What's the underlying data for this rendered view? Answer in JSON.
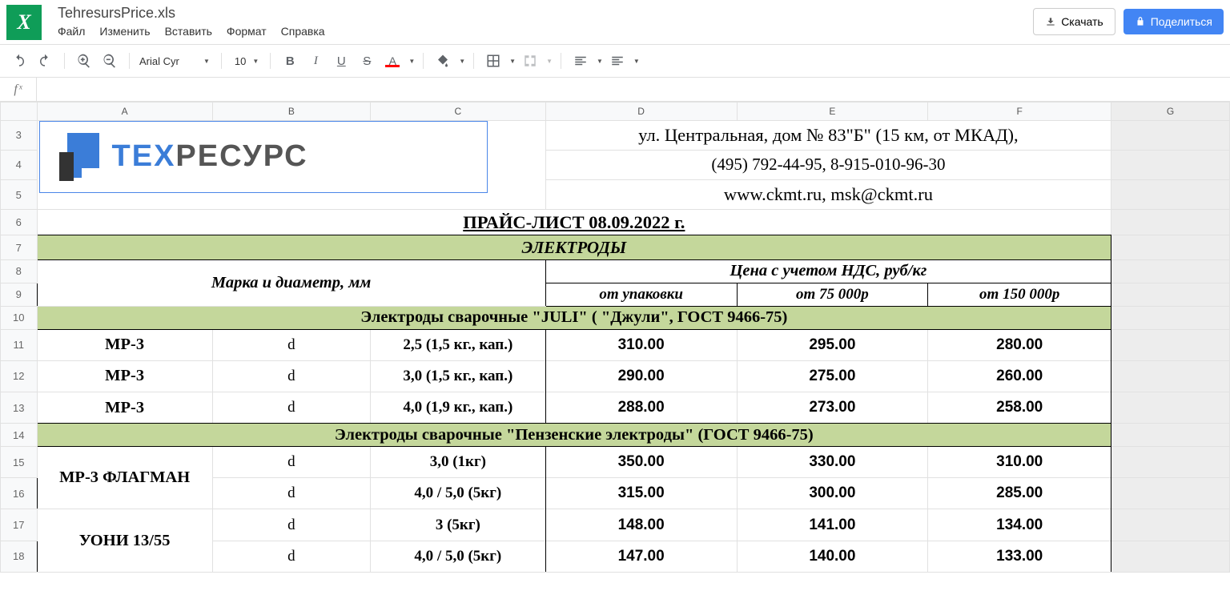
{
  "doc_title": "TehresursPrice.xls",
  "menu": [
    "Файл",
    "Изменить",
    "Вставить",
    "Формат",
    "Справка"
  ],
  "buttons": {
    "download": "Скачать",
    "share": "Поделиться"
  },
  "toolbar": {
    "font": "Arial Cyr",
    "font_size": "10"
  },
  "fx_label": "f ˣ",
  "columns": [
    "A",
    "B",
    "C",
    "D",
    "E",
    "F",
    "G"
  ],
  "rows": [
    "3",
    "4",
    "5",
    "6",
    "7",
    "8",
    "9",
    "10",
    "11",
    "12",
    "13",
    "14",
    "15",
    "16",
    "17",
    "18"
  ],
  "logo": {
    "blue": "ТЕХ",
    "gray": "РЕСУРС"
  },
  "address": {
    "line1": "ул. Центральная, дом № 83\"Б\" (15 км, от МКАД),",
    "line2": "(495) 792-44-95, 8-915-010-96-30",
    "line3": "www.ckmt.ru, msk@ckmt.ru"
  },
  "price_title": "ПРАЙС-ЛИСТ 08.09.2022 г.",
  "section": "ЭЛЕКТРОДЫ",
  "headers": {
    "brand": "Марка и диаметр, мм",
    "price": "Цена с учетом НДС, руб/кг",
    "col_d": "от упаковки",
    "col_e": "от 75 000р",
    "col_f": "от 150 000р"
  },
  "group1": "Электроды сварочные \"JULI\" ( \"Джули\", ГОСТ 9466-75)",
  "group2": "Электроды сварочные \"Пензенские электроды\" (ГОСТ 9466-75)",
  "d_label": "d",
  "rows_data": {
    "r11": {
      "brand": "МР-3",
      "size": "2,5 (1,5 кг., кап.)",
      "p1": "310.00",
      "p2": "295.00",
      "p3": "280.00"
    },
    "r12": {
      "brand": "МР-3",
      "size": "3,0 (1,5 кг., кап.)",
      "p1": "290.00",
      "p2": "275.00",
      "p3": "260.00"
    },
    "r13": {
      "brand": "МР-3",
      "size": "4,0 (1,9 кг., кап.)",
      "p1": "288.00",
      "p2": "273.00",
      "p3": "258.00"
    },
    "r15": {
      "brand": "МР-3 ФЛАГМАН",
      "size": "3,0 (1кг)",
      "p1": "350.00",
      "p2": "330.00",
      "p3": "310.00"
    },
    "r16": {
      "size": "4,0 / 5,0 (5кг)",
      "p1": "315.00",
      "p2": "300.00",
      "p3": "285.00"
    },
    "r17": {
      "brand": "УОНИ 13/55",
      "size": "3 (5кг)",
      "p1": "148.00",
      "p2": "141.00",
      "p3": "134.00"
    },
    "r18": {
      "size": "4,0 / 5,0 (5кг)",
      "p1": "147.00",
      "p2": "140.00",
      "p3": "133.00"
    }
  }
}
